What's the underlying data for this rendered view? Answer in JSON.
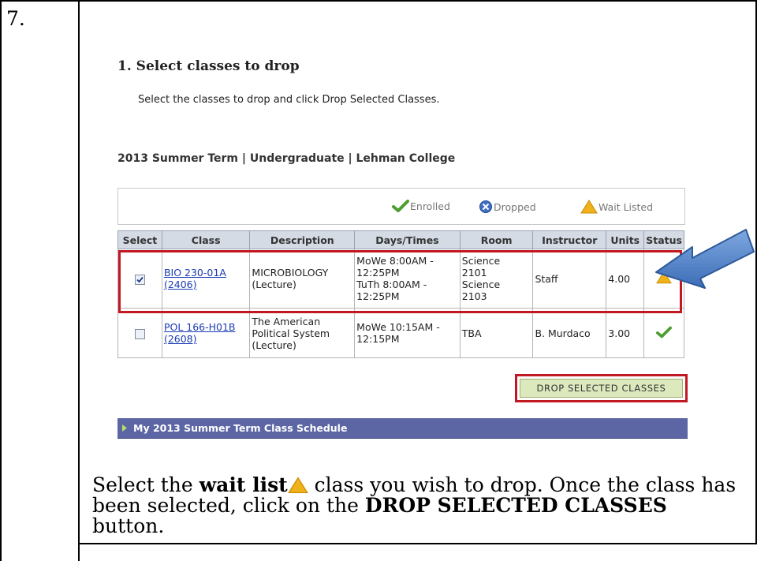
{
  "step": {
    "number": "7."
  },
  "section": {
    "title": "1.  Select classes to drop"
  },
  "instruction": "Select the classes to drop and click Drop Selected Classes.",
  "term_line": "2013 Summer Term | Undergraduate | Lehman College",
  "legend": {
    "enrolled": "Enrolled",
    "dropped": "Dropped",
    "wait_listed": "Wait Listed"
  },
  "table": {
    "headers": [
      "Select",
      "Class",
      "Description",
      "Days/Times",
      "Room",
      "Instructor",
      "Units",
      "Status"
    ],
    "rows": [
      {
        "selected": true,
        "class_code": "BIO 230-01A",
        "class_number": "(2406)",
        "description_1": "MICROBIOLOGY",
        "description_2": "(Lecture)",
        "days_1": "MoWe 8:00AM -",
        "days_2": "12:25PM",
        "days_3": "TuTh 8:00AM -",
        "days_4": "12:25PM",
        "room_1": "Science",
        "room_2": "2101",
        "room_3": "Science",
        "room_4": "2103",
        "instructor": "Staff",
        "units": "4.00",
        "status_icon": "wait-listed-icon"
      },
      {
        "selected": false,
        "class_code": "POL 166-H01B",
        "class_number": "(2608)",
        "description_1": "The American",
        "description_2": "Political System",
        "description_3": "(Lecture)",
        "days_1": "MoWe 10:15AM -",
        "days_2": "12:15PM",
        "room": "TBA",
        "instructor": "B. Murdaco",
        "units": "3.00",
        "status_icon": "enrolled-icon"
      }
    ]
  },
  "drop_button": {
    "label": "Drop Selected Classes"
  },
  "schedule_link": {
    "label": "My 2013 Summer Term Class Schedule"
  },
  "footer": {
    "part1": "Select the ",
    "bold1": "wait list",
    "part2": " class you wish to drop.  Once the class has been selected, click on the ",
    "bold2": "DROP SELECTED CLASSES",
    "part3": " button."
  },
  "colors": {
    "highlight": "#c21822",
    "schedule_bar": "#5c66a4",
    "button_bg": "#dce9bd",
    "wait_icon": "#f0b21a",
    "enrolled_icon": "#4c9d2f",
    "arrow": "#4a7fc4"
  }
}
